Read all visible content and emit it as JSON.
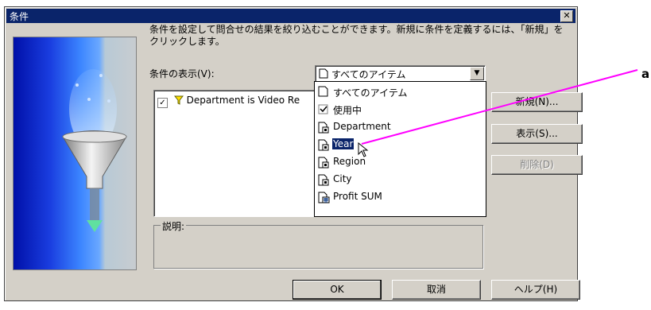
{
  "window": {
    "title": "条件",
    "close_glyph": "✕"
  },
  "description": "条件を設定して問合せの結果を絞り込むことができます。新規に条件を定義するには、「新規」をクリックします。",
  "conditions_label": "条件の表示(V):",
  "combo": {
    "value": "すべてのアイテム"
  },
  "list": {
    "item_label": "Department is Video Re"
  },
  "dropdown": {
    "items": [
      {
        "label": "すべてのアイテム",
        "icon": "page-icon"
      },
      {
        "label": "使用中",
        "icon": "checkbox-icon"
      },
      {
        "label": "Department",
        "icon": "item-icon"
      },
      {
        "label": "Year",
        "icon": "item-icon",
        "selected": true
      },
      {
        "label": "Region",
        "icon": "item-icon"
      },
      {
        "label": "City",
        "icon": "item-icon"
      },
      {
        "label": "Profit SUM",
        "icon": "calc-item-icon"
      }
    ]
  },
  "buttons": {
    "new": "新規(N)...",
    "show": "表示(S)...",
    "delete": "削除(D)",
    "ok": "OK",
    "cancel": "取消",
    "help": "ヘルプ(H)"
  },
  "description_group": {
    "label": "説明:"
  },
  "callout": {
    "label": "a",
    "color": "#ff00ff"
  },
  "colors": {
    "title_bar": "#0a246a",
    "dialog_bg": "#d4d0c8",
    "selection": "#0a246a"
  }
}
